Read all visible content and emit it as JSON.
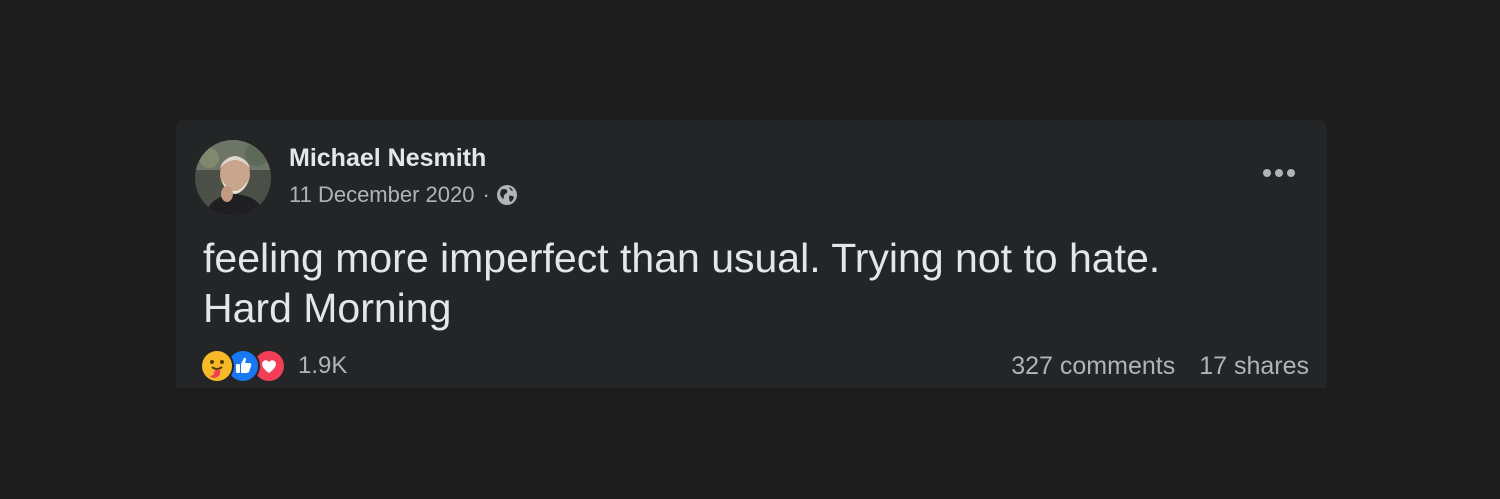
{
  "post": {
    "author": "Michael Nesmith",
    "date": "11 December 2020",
    "separator": "·",
    "privacy_icon": "globe-icon",
    "text_lines": [
      "feeling more imperfect than usual. Trying not to hate.",
      "Hard Morning"
    ],
    "reactions": {
      "icons": [
        "care-icon",
        "like-icon",
        "love-icon"
      ],
      "count": "1.9K"
    },
    "comments": "327 comments",
    "shares": "17 shares"
  },
  "colors": {
    "page_background": "#1c1c1c",
    "card_background": "#242527",
    "primary_text": "#e4e6eb",
    "secondary_text": "#b0b3b8",
    "like_blue": "#1877f2",
    "love_red": "#f33e58",
    "care_yellow": "#f7b928"
  }
}
